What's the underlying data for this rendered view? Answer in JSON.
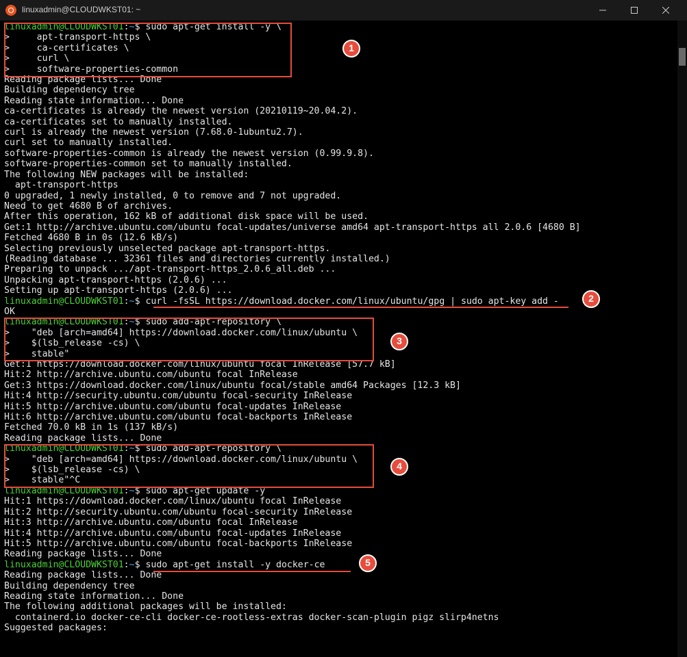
{
  "titlebar": {
    "title": "linuxadmin@CLOUDWKST01: ~"
  },
  "prompt_user_host": "linuxadmin@CLOUDWKST01",
  "prompt_sep": ":",
  "prompt_path": "~",
  "prompt_dollar": "$",
  "lines": {
    "l1_cmd": " sudo apt-get install -y \\",
    "l2": ">     apt-transport-https \\",
    "l3": ">     ca-certificates \\",
    "l4": ">     curl \\",
    "l5": ">     software-properties-common",
    "l6": "Reading package lists... Done",
    "l7": "Building dependency tree",
    "l8": "Reading state information... Done",
    "l9": "ca-certificates is already the newest version (20210119~20.04.2).",
    "l10": "ca-certificates set to manually installed.",
    "l11": "curl is already the newest version (7.68.0-1ubuntu2.7).",
    "l12": "curl set to manually installed.",
    "l13": "software-properties-common is already the newest version (0.99.9.8).",
    "l14": "software-properties-common set to manually installed.",
    "l15": "The following NEW packages will be installed:",
    "l16": "  apt-transport-https",
    "l17": "0 upgraded, 1 newly installed, 0 to remove and 7 not upgraded.",
    "l18": "Need to get 4680 B of archives.",
    "l19": "After this operation, 162 kB of additional disk space will be used.",
    "l20": "Get:1 http://archive.ubuntu.com/ubuntu focal-updates/universe amd64 apt-transport-https all 2.0.6 [4680 B]",
    "l21": "Fetched 4680 B in 0s (12.6 kB/s)",
    "l22": "Selecting previously unselected package apt-transport-https.",
    "l23": "(Reading database ... 32361 files and directories currently installed.)",
    "l24": "Preparing to unpack .../apt-transport-https_2.0.6_all.deb ...",
    "l25": "Unpacking apt-transport-https (2.0.6) ...",
    "l26": "Setting up apt-transport-https (2.0.6) ...",
    "l27_cmd": " curl -fsSL https://download.docker.com/linux/ubuntu/gpg | sudo apt-key add -",
    "l28": "OK",
    "l29_cmd": " sudo add-apt-repository \\",
    "l30": ">    \"deb [arch=amd64] https://download.docker.com/linux/ubuntu \\",
    "l31": ">    $(lsb_release -cs) \\",
    "l32": ">    stable\"",
    "l33": "Get:1 https://download.docker.com/linux/ubuntu focal InRelease [57.7 kB]",
    "l34": "Hit:2 http://archive.ubuntu.com/ubuntu focal InRelease",
    "l35": "Get:3 https://download.docker.com/linux/ubuntu focal/stable amd64 Packages [12.3 kB]",
    "l36": "Hit:4 http://security.ubuntu.com/ubuntu focal-security InRelease",
    "l37": "Hit:5 http://archive.ubuntu.com/ubuntu focal-updates InRelease",
    "l38": "Hit:6 http://archive.ubuntu.com/ubuntu focal-backports InRelease",
    "l39": "Fetched 70.0 kB in 1s (137 kB/s)",
    "l40": "Reading package lists... Done",
    "l41_cmd": " sudo add-apt-repository \\",
    "l42": ">    \"deb [arch=amd64] https://download.docker.com/linux/ubuntu \\",
    "l43": ">    $(lsb_release -cs) \\",
    "l44": ">    stable\"^C",
    "l45_cmd": " sudo apt-get update -y",
    "l46": "Hit:1 https://download.docker.com/linux/ubuntu focal InRelease",
    "l47": "Hit:2 http://security.ubuntu.com/ubuntu focal-security InRelease",
    "l48": "Hit:3 http://archive.ubuntu.com/ubuntu focal InRelease",
    "l49": "Hit:4 http://archive.ubuntu.com/ubuntu focal-updates InRelease",
    "l50": "Hit:5 http://archive.ubuntu.com/ubuntu focal-backports InRelease",
    "l51": "Reading package lists... Done",
    "l52_cmd": " sudo apt-get install -y docker-ce",
    "l53": "Reading package lists... Done",
    "l54": "Building dependency tree",
    "l55": "Reading state information... Done",
    "l56": "The following additional packages will be installed:",
    "l57": "  containerd.io docker-ce-cli docker-ce-rootless-extras docker-scan-plugin pigz slirp4netns",
    "l58": "Suggested packages:"
  },
  "annotations": {
    "a1": "1",
    "a2": "2",
    "a3": "3",
    "a4": "4",
    "a5": "5"
  }
}
